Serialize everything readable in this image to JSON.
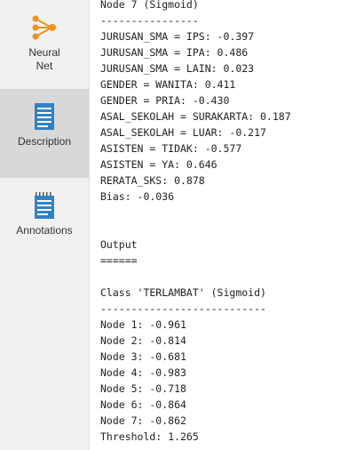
{
  "sidebar": {
    "items": [
      {
        "label": "Neural\nNet",
        "icon": "neural-net-icon",
        "active": false
      },
      {
        "label": "Description",
        "icon": "document-icon",
        "active": true
      },
      {
        "label": "Annotations",
        "icon": "notepad-icon",
        "active": false
      }
    ]
  },
  "colors": {
    "accent": "#f0921e",
    "doc_blue": "#2f82c8"
  },
  "lines": [
    "Node 7 (Sigmoid)",
    "----------------",
    "JURUSAN_SMA = IPS: -0.397",
    "JURUSAN_SMA = IPA: 0.486",
    "JURUSAN_SMA = LAIN: 0.023",
    "GENDER = WANITA: 0.411",
    "GENDER = PRIA: -0.430",
    "ASAL_SEKOLAH = SURAKARTA: 0.187",
    "ASAL_SEKOLAH = LUAR: -0.217",
    "ASISTEN = TIDAK: -0.577",
    "ASISTEN = YA: 0.646",
    "RERATA_SKS: 0.878",
    "Bias: -0.036",
    "",
    "",
    "Output",
    "======",
    "",
    "Class 'TERLAMBAT' (Sigmoid)",
    "---------------------------",
    "Node 1: -0.961",
    "Node 2: -0.814",
    "Node 3: -0.681",
    "Node 4: -0.983",
    "Node 5: -0.718",
    "Node 6: -0.864",
    "Node 7: -0.862",
    "Threshold: 1.265"
  ]
}
